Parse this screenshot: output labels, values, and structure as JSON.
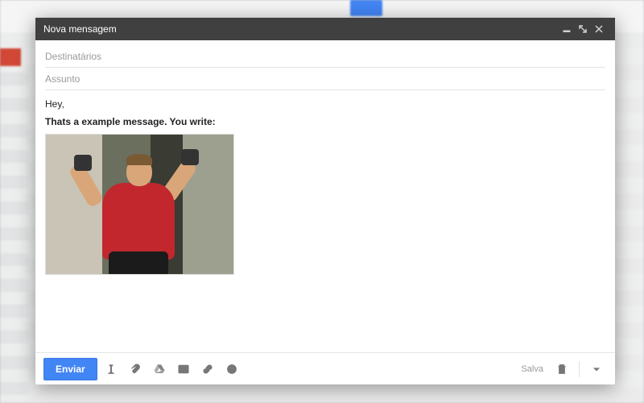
{
  "compose": {
    "title": "Nova mensagem",
    "recipients_placeholder": "Destinatários",
    "subject_placeholder": "Assunto",
    "recipients_value": "",
    "subject_value": "",
    "body": {
      "line1": "Hey,",
      "line2": "Thats a example message. You write:"
    },
    "toolbar": {
      "send_label": "Enviar",
      "saved_label": "Salva"
    }
  }
}
